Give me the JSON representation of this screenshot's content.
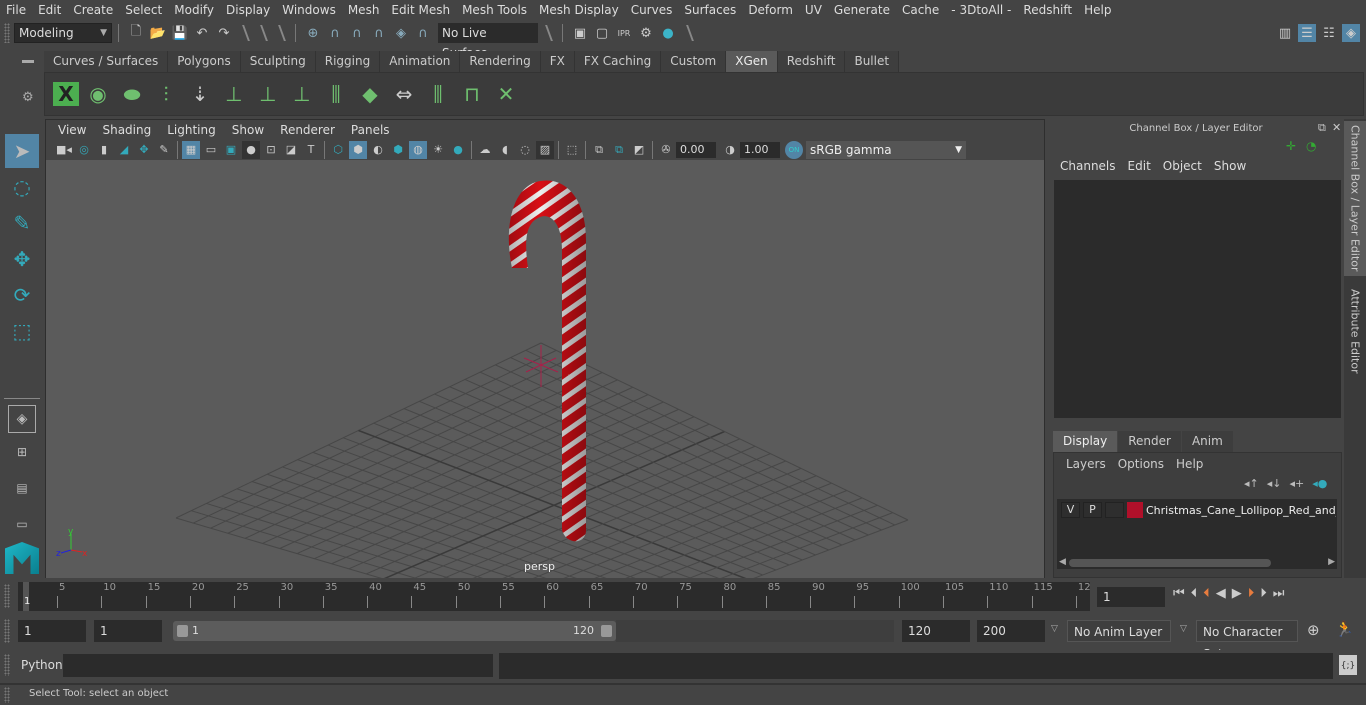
{
  "menubar": [
    "File",
    "Edit",
    "Create",
    "Select",
    "Modify",
    "Display",
    "Windows",
    "Mesh",
    "Edit Mesh",
    "Mesh Tools",
    "Mesh Display",
    "Curves",
    "Surfaces",
    "Deform",
    "UV",
    "Generate",
    "Cache",
    "- 3DtoAll -",
    "Redshift",
    "Help"
  ],
  "statusline": {
    "mode": "Modeling",
    "live_surface": "No Live Surface",
    "icons": [
      "new-scene-icon",
      "open-scene-icon",
      "save-scene-icon",
      "undo-icon",
      "redo-icon"
    ],
    "snap_icons": [
      "snap-grid-icon",
      "snap-curve-icon",
      "snap-point-icon",
      "snap-view-plane-icon",
      "snap-surface-icon",
      "make-live-icon"
    ],
    "render_icons": [
      "render-view-icon",
      "render-frame-icon",
      "ipr-render-icon",
      "render-settings-icon",
      "hypershade-icon"
    ],
    "right_icons": [
      "modeling-toolkit-icon",
      "attribute-editor-icon",
      "tool-settings-icon",
      "channel-box-icon"
    ]
  },
  "shelf": {
    "tabs": [
      "Curves / Surfaces",
      "Polygons",
      "Sculpting",
      "Rigging",
      "Animation",
      "Rendering",
      "FX",
      "FX Caching",
      "Custom",
      "XGen",
      "Redshift",
      "Bullet"
    ],
    "active_tab": "XGen",
    "icons": [
      "xgen-editor-icon",
      "xgen-preview-icon",
      "xgen-clear-preview-icon",
      "create-description-icon",
      "place-guides-icon",
      "add-guide-icon",
      "select-guide-icon",
      "lock-guide-icon",
      "guide-length-icon",
      "patch-icon",
      "flip-guides-icon",
      "interactive-groom-icon",
      "groom-splines-icon",
      "delete-groom-icon"
    ]
  },
  "toolbox": {
    "tools": [
      "select-tool-icon",
      "lasso-tool-icon",
      "paint-select-icon",
      "move-tool-icon",
      "rotate-tool-icon",
      "scale-tool-icon"
    ],
    "layouts": [
      "single-pane-layout-icon",
      "four-pane-layout-icon",
      "outliner-layout-icon",
      "persp-graph-layout-icon"
    ]
  },
  "viewport": {
    "menu": [
      "View",
      "Shading",
      "Lighting",
      "Show",
      "Renderer",
      "Panels"
    ],
    "exposure": "0.00",
    "gamma": "1.00",
    "color_space": "sRGB gamma",
    "camera_label": "persp",
    "axis": {
      "x": "x",
      "y": "y",
      "z": "z"
    }
  },
  "channel_box": {
    "title": "Channel Box / Layer Editor",
    "menu": [
      "Channels",
      "Edit",
      "Object",
      "Show"
    ]
  },
  "layer_editor": {
    "tabs": [
      "Display",
      "Render",
      "Anim"
    ],
    "active_tab": "Display",
    "menu": [
      "Layers",
      "Options",
      "Help"
    ],
    "layers": [
      {
        "v": "V",
        "p": "P",
        "color": "#b0102a",
        "name": "Christmas_Cane_Lollipop_Red_and_G"
      }
    ]
  },
  "side_tabs": [
    "Channel Box / Layer Editor",
    "Attribute Editor"
  ],
  "timeline": {
    "ticks": [
      "5",
      "10",
      "15",
      "20",
      "25",
      "30",
      "35",
      "40",
      "45",
      "50",
      "55",
      "60",
      "65",
      "70",
      "75",
      "80",
      "85",
      "90",
      "95",
      "100",
      "105",
      "110",
      "115",
      "12"
    ],
    "current_marker": "1",
    "current_frame": "1"
  },
  "range": {
    "start": "1",
    "playback_start": "1",
    "slider_start": "1",
    "slider_end": "120",
    "playback_end": "120",
    "end": "200",
    "anim_layer": "No Anim Layer",
    "character_set": "No Character Set"
  },
  "command": {
    "language": "Python",
    "input": "",
    "output": ""
  },
  "help_line": "Select Tool: select an object"
}
